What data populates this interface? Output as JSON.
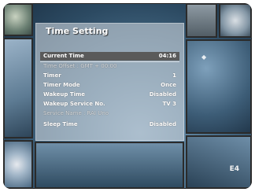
{
  "menu": {
    "title": "Time Setting",
    "items": [
      {
        "label": "Current Time",
        "value": "04:16"
      },
      {
        "label": "Time Offset : GMT + 00:00",
        "value": ""
      },
      {
        "label": "Timer",
        "value": "1"
      },
      {
        "label": "Timer Mode",
        "value": "Once"
      },
      {
        "label": "Wakeup Time",
        "value": "Disabled"
      },
      {
        "label": "Wakeup Service No.",
        "value": "TV 3"
      },
      {
        "label": "Service Name : RAI Uno",
        "value": ""
      },
      {
        "label": "Sleep Time",
        "value": "Disabled"
      }
    ]
  },
  "overlay": {
    "tile_mark": "◆",
    "corner_mark": "E4"
  }
}
